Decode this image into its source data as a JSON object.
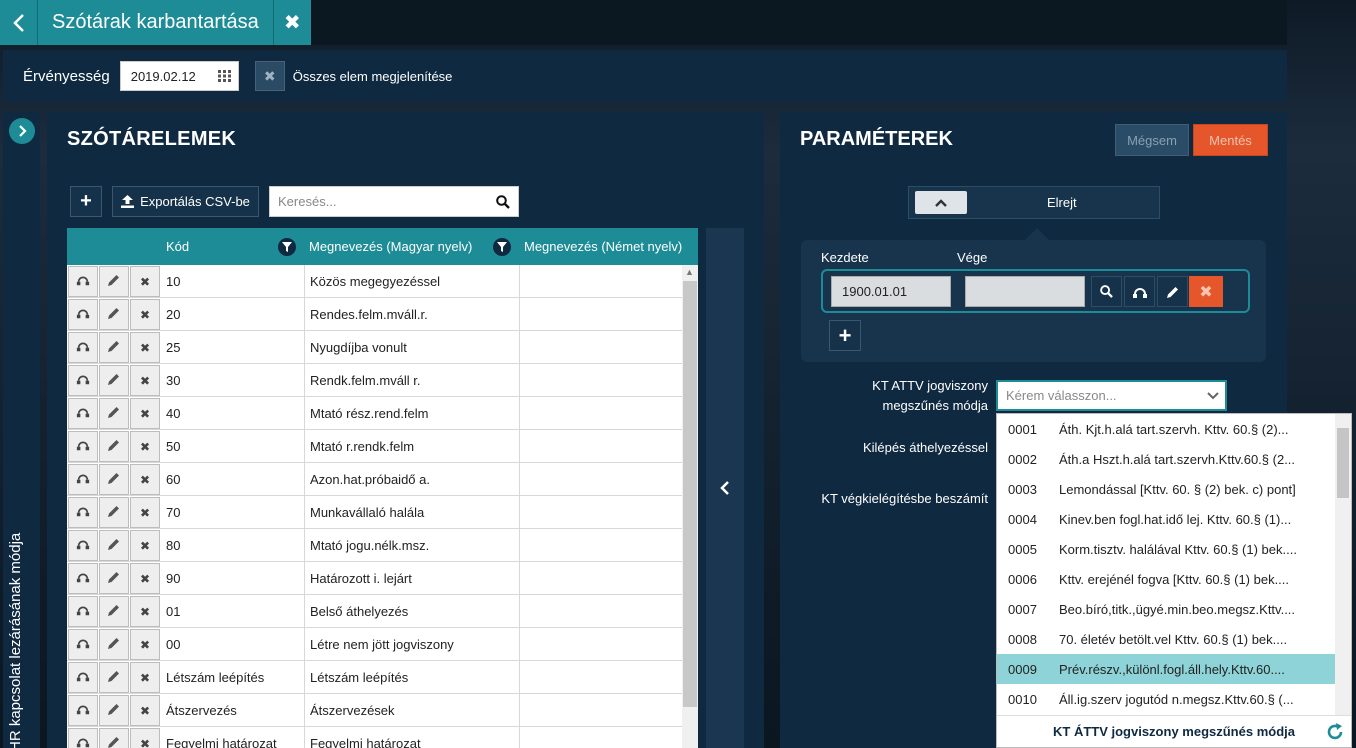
{
  "header": {
    "title": "Szótárak karbantartása"
  },
  "validity": {
    "label": "Érvényesség",
    "date": "2019.02.12",
    "show_all_label": "Összes elem megjelenítése"
  },
  "side_label": "HR kapcsolat lezárásának módja",
  "left_panel": {
    "title": "SZÓTÁRELEMEK",
    "export_label": "Exportálás CSV-be",
    "search_placeholder": "Keresés...",
    "columns": [
      "Kód",
      "Megnevezés (Magyar nyelv)",
      "Megnevezés (Német nyelv)"
    ],
    "rows": [
      {
        "kod": "10",
        "hu": "Közös megegyezéssel",
        "de": ""
      },
      {
        "kod": "20",
        "hu": "Rendes.felm.mváll.r.",
        "de": ""
      },
      {
        "kod": "25",
        "hu": "Nyugdíjba vonult",
        "de": ""
      },
      {
        "kod": "30",
        "hu": "Rendk.felm.mváll r.",
        "de": ""
      },
      {
        "kod": "40",
        "hu": "Mtató rész.rend.felm",
        "de": ""
      },
      {
        "kod": "50",
        "hu": "Mtató r.rendk.felm",
        "de": ""
      },
      {
        "kod": "60",
        "hu": "Azon.hat.próbaidő a.",
        "de": ""
      },
      {
        "kod": "70",
        "hu": "Munkavállaló halála",
        "de": ""
      },
      {
        "kod": "80",
        "hu": "Mtató jogu.nélk.msz.",
        "de": ""
      },
      {
        "kod": "90",
        "hu": "Határozott i. lejárt",
        "de": ""
      },
      {
        "kod": "01",
        "hu": "Belső áthelyezés",
        "de": ""
      },
      {
        "kod": "00",
        "hu": "Létre nem jött jogviszony",
        "de": ""
      },
      {
        "kod": "Létszám leépítés",
        "hu": "Létszám leépítés",
        "de": ""
      },
      {
        "kod": "Átszervezés",
        "hu": "Átszervezések",
        "de": ""
      },
      {
        "kod": "Fegyelmi határozat",
        "hu": "Fegyelmi határozat",
        "de": ""
      }
    ]
  },
  "right_panel": {
    "title": "PARAMÉTEREK",
    "cancel_label": "Mégsem",
    "save_label": "Mentés",
    "hide_label": "Elrejt",
    "start_label": "Kezdete",
    "end_label": "Vége",
    "start_value": "1900.01.01",
    "end_value": "",
    "fields": {
      "kt_attv_label_1": "KT ATTV jogviszony",
      "kt_attv_label_2": "megszűnés módja",
      "kilepes_label": "Kilépés áthelyezéssel",
      "vegkielegites_label": "KT végkielégítésbe beszámít",
      "select_placeholder": "Kérem válasszon..."
    }
  },
  "dropdown": {
    "items": [
      {
        "code": "0001",
        "text": "Áth. Kjt.h.alá tart.szervh. Kttv. 60.§ (2)..."
      },
      {
        "code": "0002",
        "text": "Áth.a Hszt.h.alá tart.szervh.Kttv.60.§ (2..."
      },
      {
        "code": "0003",
        "text": "Lemondással [Kttv. 60. § (2) bek. c) pont]"
      },
      {
        "code": "0004",
        "text": "Kinev.ben fogl.hat.idő lej. Kttv. 60.§ (1)..."
      },
      {
        "code": "0005",
        "text": "Korm.tisztv. halálával Kttv. 60.§ (1) bek...."
      },
      {
        "code": "0006",
        "text": "Kttv. erejénél fogva [Kttv. 60.§ (1) bek...."
      },
      {
        "code": "0007",
        "text": "Beo.bíró,titk.,ügyé.min.beo.megsz.Kttv...."
      },
      {
        "code": "0008",
        "text": "70. életév betölt.vel Kttv. 60.§ (1) bek...."
      },
      {
        "code": "0009",
        "text": "Prév.részv.,különl.fogl.áll.hely.Kttv.60...."
      },
      {
        "code": "0010",
        "text": "Áll.ig.szerv jogutód n.megsz.Kttv.60.§ (..."
      }
    ],
    "selected_code": "0009",
    "footer": "KT ÁTTV jogviszony megszűnés módja"
  },
  "colors": {
    "accent": "#1d8c96",
    "panel": "#0f2940",
    "save": "#e5572b",
    "selected": "#8ed3d8"
  }
}
